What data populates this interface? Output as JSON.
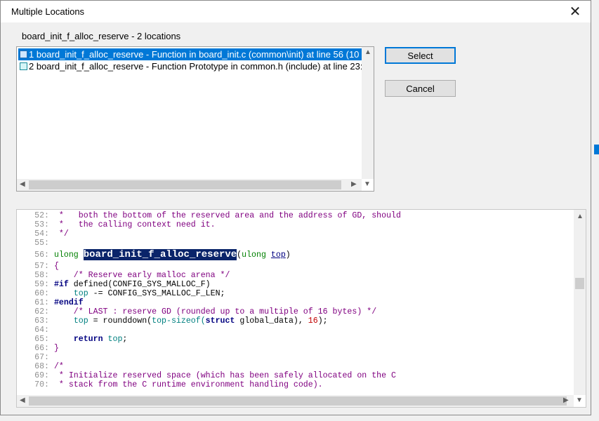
{
  "window": {
    "title": "Multiple Locations"
  },
  "heading": "board_init_f_alloc_reserve - 2 locations",
  "locations": [
    {
      "text": "1 board_init_f_alloc_reserve - Function in board_init.c (common\\init) at line 56 (10"
    },
    {
      "text": "2 board_init_f_alloc_reserve - Function Prototype in common.h (include) at line 23:"
    }
  ],
  "buttons": {
    "select": "Select",
    "cancel": "Cancel"
  },
  "code": {
    "l52": {
      "n": "52:",
      "t": " *   both the bottom of the reserved area and the address of GD, should"
    },
    "l53": {
      "n": "53:",
      "t": " *   the calling context need it."
    },
    "l54": {
      "n": "54:",
      "t": " */"
    },
    "l55": {
      "n": "55:",
      "t": ""
    },
    "l56": {
      "n": "56:",
      "type": "ulong",
      "fn": "board_init_f_alloc_reserve",
      "open": "(",
      "ptype": "ulong",
      "param": "top",
      "close": ")"
    },
    "l57": {
      "n": "57:",
      "t": "{"
    },
    "l58": {
      "n": "58:",
      "t": "    /* Reserve early malloc arena */"
    },
    "l59": {
      "n": "59:",
      "kw": "#if",
      "rest": " defined(CONFIG_SYS_MALLOC_F)"
    },
    "l60": {
      "n": "60:",
      "ind": "    ",
      "var": "top",
      "rest": " -= CONFIG_SYS_MALLOC_F_LEN;"
    },
    "l61": {
      "n": "61:",
      "kw": "#endif"
    },
    "l62": {
      "n": "62:",
      "t": "    /* LAST : reserve GD (rounded up to a multiple of 16 bytes) */"
    },
    "l63": {
      "n": "63:",
      "ind": "    ",
      "var": "top",
      "p1": " = rounddown(",
      "var2": "top-sizeof(",
      "kw": "struct",
      "p2": " global_data), ",
      "num": "16",
      "p3": ");"
    },
    "l64": {
      "n": "64:",
      "t": ""
    },
    "l65": {
      "n": "65:",
      "ind": "    ",
      "kw": "return",
      "sp": " ",
      "var": "top",
      "end": ";"
    },
    "l66": {
      "n": "66:",
      "t": "}"
    },
    "l67": {
      "n": "67:",
      "t": ""
    },
    "l68": {
      "n": "68:",
      "t": "/*"
    },
    "l69": {
      "n": "69:",
      "t": " * Initialize reserved space (which has been safely allocated on the C"
    },
    "l70": {
      "n": "70:",
      "t": " * stack from the C runtime environment handling code)."
    }
  }
}
